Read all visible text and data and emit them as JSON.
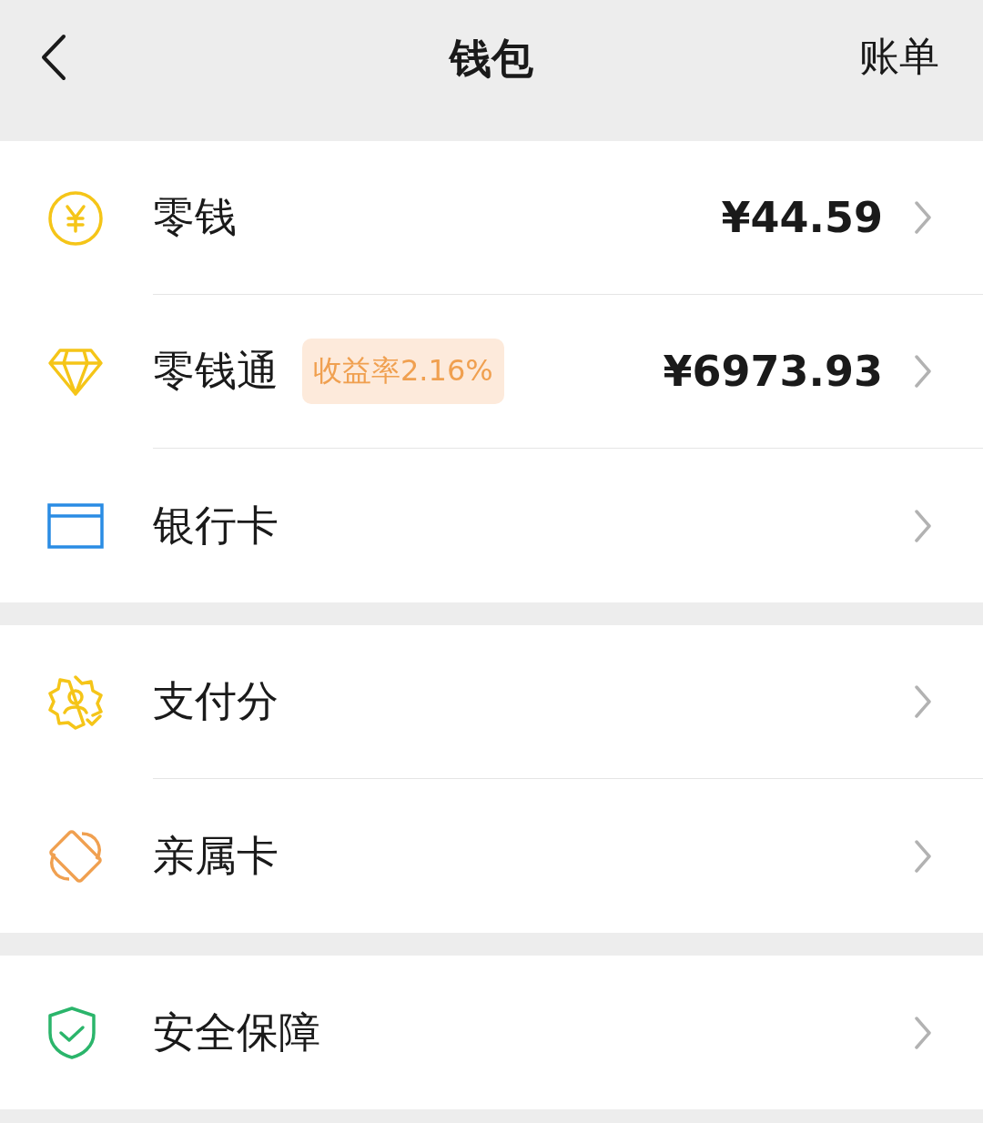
{
  "header": {
    "title": "钱包",
    "action": "账单"
  },
  "sections": [
    {
      "rows": [
        {
          "label": "零钱",
          "value": "¥44.59"
        },
        {
          "label": "零钱通",
          "badge": "收益率2.16%",
          "value": "¥6973.93"
        },
        {
          "label": "银行卡"
        }
      ]
    },
    {
      "rows": [
        {
          "label": "支付分"
        },
        {
          "label": "亲属卡"
        }
      ]
    },
    {
      "rows": [
        {
          "label": "安全保障"
        }
      ]
    }
  ]
}
